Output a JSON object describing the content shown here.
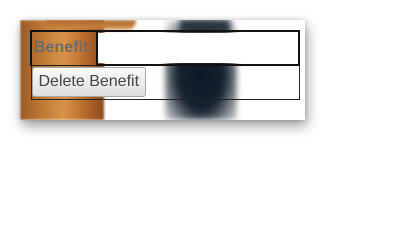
{
  "form": {
    "benefit_label": "Benefit:",
    "benefit_value": "",
    "delete_button_label": "Delete Benefit"
  },
  "colors": {
    "label_text": "#6c6c6c",
    "border": "#111111",
    "button_bg": "#ebebeb",
    "button_border": "#a8a8a8"
  }
}
